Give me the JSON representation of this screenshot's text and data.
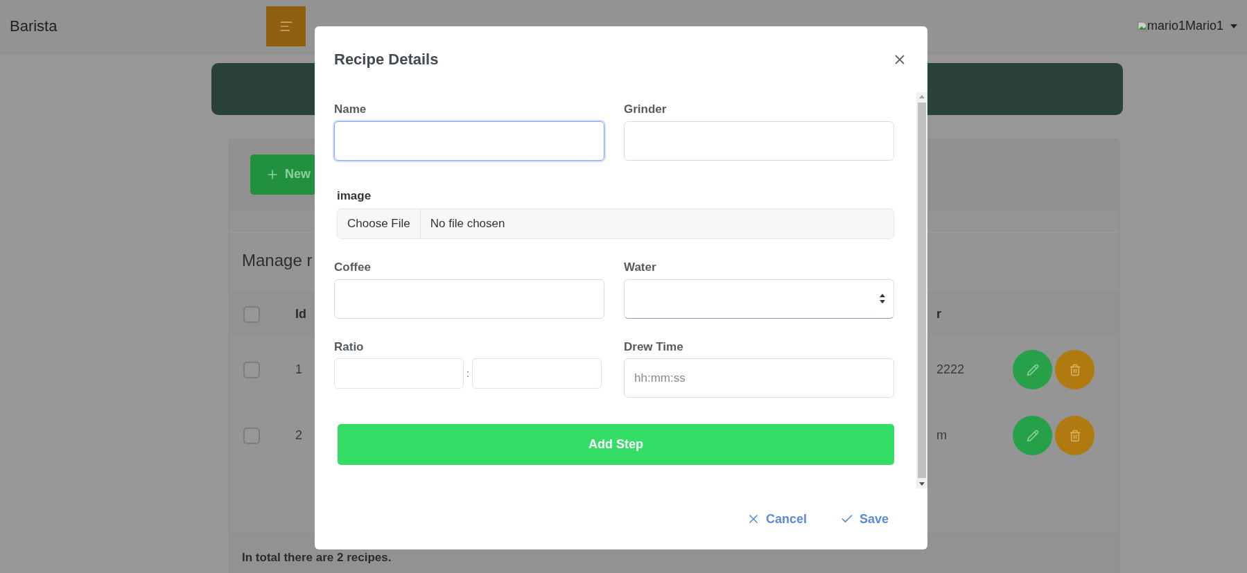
{
  "navbar": {
    "brand": "Barista",
    "user": {
      "avatar_alt": "mario1",
      "name": "Mario1"
    }
  },
  "toolbar": {
    "new_button": "New"
  },
  "section_title": "Manage r",
  "table": {
    "header_checked": false,
    "columns": [
      {
        "label": "Id"
      },
      {
        "label": "r"
      }
    ],
    "rows": [
      {
        "checked": false,
        "id": "1",
        "column_4": "2222"
      },
      {
        "checked": false,
        "id": "2",
        "column_4": "m"
      }
    ]
  },
  "footer": "In total there are 2 recipes.",
  "modal": {
    "title": "Recipe Details",
    "rows": [
      [
        {
          "kind": "text",
          "label": "Name",
          "focused": true
        },
        {
          "kind": "text",
          "label": "Grinder",
          "focused": false
        }
      ],
      [
        {
          "kind": "file",
          "label": "image",
          "button": "Choose File",
          "status": "No file chosen"
        }
      ],
      [
        {
          "kind": "text",
          "label": "Coffee",
          "focused": false
        },
        {
          "kind": "number",
          "label": "Water",
          "focused": false
        }
      ],
      [
        {
          "kind": "ratio",
          "label": "Ratio",
          "separator": ":"
        },
        {
          "kind": "text",
          "label": "Drew Time",
          "placeholder": "hh:mm:ss",
          "focused": false
        }
      ]
    ],
    "add_step": "Add Step",
    "cancel": "Cancel",
    "save": "Save"
  }
}
